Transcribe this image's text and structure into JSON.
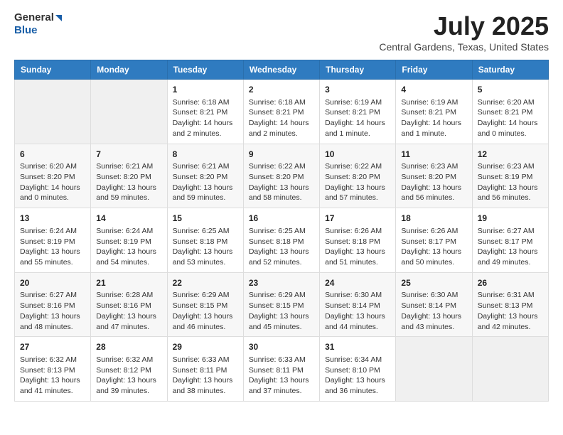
{
  "header": {
    "logo_general": "General",
    "logo_blue": "Blue",
    "month": "July 2025",
    "location": "Central Gardens, Texas, United States"
  },
  "weekdays": [
    "Sunday",
    "Monday",
    "Tuesday",
    "Wednesday",
    "Thursday",
    "Friday",
    "Saturday"
  ],
  "weeks": [
    [
      {
        "day": "",
        "info": ""
      },
      {
        "day": "",
        "info": ""
      },
      {
        "day": "1",
        "info": "Sunrise: 6:18 AM\nSunset: 8:21 PM\nDaylight: 14 hours and 2 minutes."
      },
      {
        "day": "2",
        "info": "Sunrise: 6:18 AM\nSunset: 8:21 PM\nDaylight: 14 hours and 2 minutes."
      },
      {
        "day": "3",
        "info": "Sunrise: 6:19 AM\nSunset: 8:21 PM\nDaylight: 14 hours and 1 minute."
      },
      {
        "day": "4",
        "info": "Sunrise: 6:19 AM\nSunset: 8:21 PM\nDaylight: 14 hours and 1 minute."
      },
      {
        "day": "5",
        "info": "Sunrise: 6:20 AM\nSunset: 8:21 PM\nDaylight: 14 hours and 0 minutes."
      }
    ],
    [
      {
        "day": "6",
        "info": "Sunrise: 6:20 AM\nSunset: 8:20 PM\nDaylight: 14 hours and 0 minutes."
      },
      {
        "day": "7",
        "info": "Sunrise: 6:21 AM\nSunset: 8:20 PM\nDaylight: 13 hours and 59 minutes."
      },
      {
        "day": "8",
        "info": "Sunrise: 6:21 AM\nSunset: 8:20 PM\nDaylight: 13 hours and 59 minutes."
      },
      {
        "day": "9",
        "info": "Sunrise: 6:22 AM\nSunset: 8:20 PM\nDaylight: 13 hours and 58 minutes."
      },
      {
        "day": "10",
        "info": "Sunrise: 6:22 AM\nSunset: 8:20 PM\nDaylight: 13 hours and 57 minutes."
      },
      {
        "day": "11",
        "info": "Sunrise: 6:23 AM\nSunset: 8:20 PM\nDaylight: 13 hours and 56 minutes."
      },
      {
        "day": "12",
        "info": "Sunrise: 6:23 AM\nSunset: 8:19 PM\nDaylight: 13 hours and 56 minutes."
      }
    ],
    [
      {
        "day": "13",
        "info": "Sunrise: 6:24 AM\nSunset: 8:19 PM\nDaylight: 13 hours and 55 minutes."
      },
      {
        "day": "14",
        "info": "Sunrise: 6:24 AM\nSunset: 8:19 PM\nDaylight: 13 hours and 54 minutes."
      },
      {
        "day": "15",
        "info": "Sunrise: 6:25 AM\nSunset: 8:18 PM\nDaylight: 13 hours and 53 minutes."
      },
      {
        "day": "16",
        "info": "Sunrise: 6:25 AM\nSunset: 8:18 PM\nDaylight: 13 hours and 52 minutes."
      },
      {
        "day": "17",
        "info": "Sunrise: 6:26 AM\nSunset: 8:18 PM\nDaylight: 13 hours and 51 minutes."
      },
      {
        "day": "18",
        "info": "Sunrise: 6:26 AM\nSunset: 8:17 PM\nDaylight: 13 hours and 50 minutes."
      },
      {
        "day": "19",
        "info": "Sunrise: 6:27 AM\nSunset: 8:17 PM\nDaylight: 13 hours and 49 minutes."
      }
    ],
    [
      {
        "day": "20",
        "info": "Sunrise: 6:27 AM\nSunset: 8:16 PM\nDaylight: 13 hours and 48 minutes."
      },
      {
        "day": "21",
        "info": "Sunrise: 6:28 AM\nSunset: 8:16 PM\nDaylight: 13 hours and 47 minutes."
      },
      {
        "day": "22",
        "info": "Sunrise: 6:29 AM\nSunset: 8:15 PM\nDaylight: 13 hours and 46 minutes."
      },
      {
        "day": "23",
        "info": "Sunrise: 6:29 AM\nSunset: 8:15 PM\nDaylight: 13 hours and 45 minutes."
      },
      {
        "day": "24",
        "info": "Sunrise: 6:30 AM\nSunset: 8:14 PM\nDaylight: 13 hours and 44 minutes."
      },
      {
        "day": "25",
        "info": "Sunrise: 6:30 AM\nSunset: 8:14 PM\nDaylight: 13 hours and 43 minutes."
      },
      {
        "day": "26",
        "info": "Sunrise: 6:31 AM\nSunset: 8:13 PM\nDaylight: 13 hours and 42 minutes."
      }
    ],
    [
      {
        "day": "27",
        "info": "Sunrise: 6:32 AM\nSunset: 8:13 PM\nDaylight: 13 hours and 41 minutes."
      },
      {
        "day": "28",
        "info": "Sunrise: 6:32 AM\nSunset: 8:12 PM\nDaylight: 13 hours and 39 minutes."
      },
      {
        "day": "29",
        "info": "Sunrise: 6:33 AM\nSunset: 8:11 PM\nDaylight: 13 hours and 38 minutes."
      },
      {
        "day": "30",
        "info": "Sunrise: 6:33 AM\nSunset: 8:11 PM\nDaylight: 13 hours and 37 minutes."
      },
      {
        "day": "31",
        "info": "Sunrise: 6:34 AM\nSunset: 8:10 PM\nDaylight: 13 hours and 36 minutes."
      },
      {
        "day": "",
        "info": ""
      },
      {
        "day": "",
        "info": ""
      }
    ]
  ]
}
